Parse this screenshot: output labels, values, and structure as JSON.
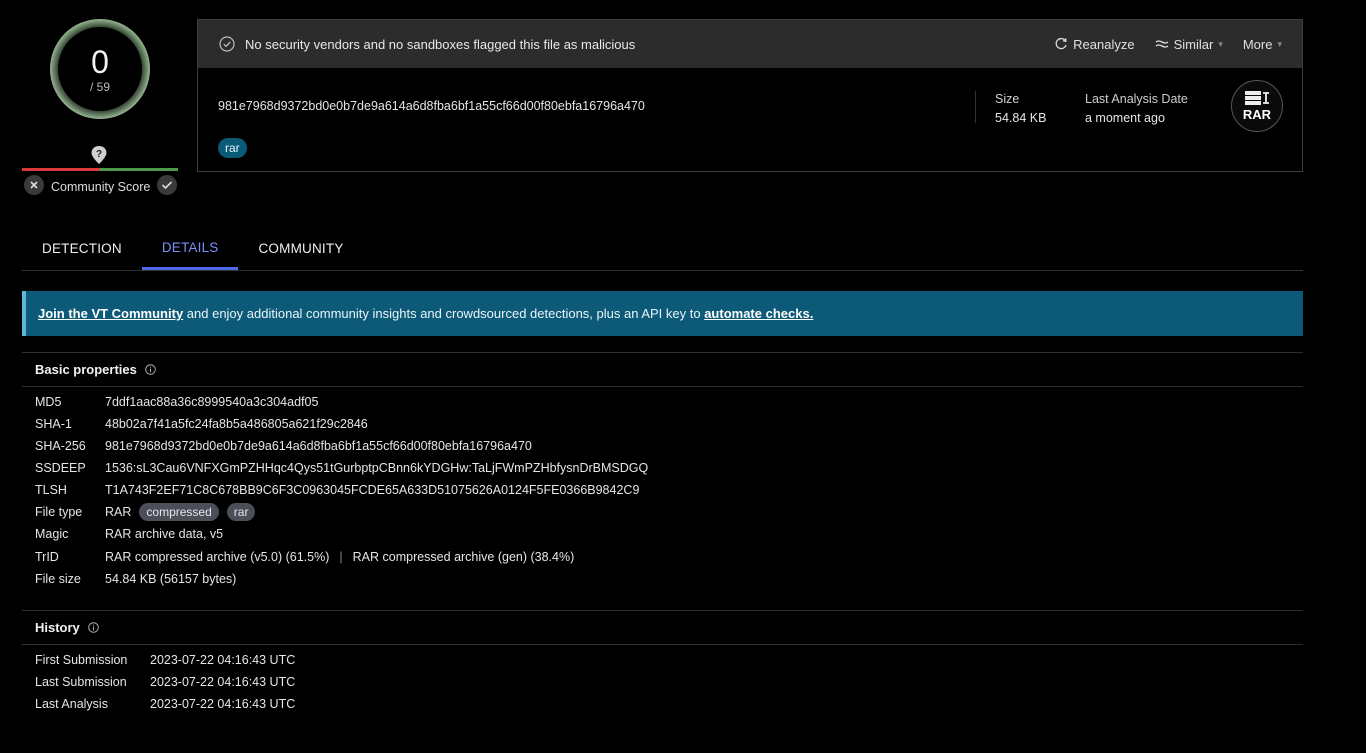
{
  "score": {
    "detections": "0",
    "total": "/ 59"
  },
  "community": {
    "label": "Community Score"
  },
  "banner": {
    "message": "No security vendors and no sandboxes flagged this file as malicious",
    "actions": {
      "reanalyze": "Reanalyze",
      "similar": "Similar",
      "more": "More"
    }
  },
  "file": {
    "hash": "981e7968d9372bd0e0b7de9a614a6d8fba6bf1a55cf66d00f80ebfa16796a470",
    "tag": "rar",
    "size_label": "Size",
    "size_value": "54.84 KB",
    "date_label": "Last Analysis Date",
    "date_value": "a moment ago",
    "type_icon_label": "RAR"
  },
  "tabs": [
    {
      "label": "DETECTION",
      "active": false
    },
    {
      "label": "DETAILS",
      "active": true
    },
    {
      "label": "COMMUNITY",
      "active": false
    }
  ],
  "info_banner": {
    "link1": "Join the VT Community",
    "middle": " and enjoy additional community insights and crowdsourced detections, plus an API key to ",
    "link2": "automate checks."
  },
  "basic": {
    "title": "Basic properties",
    "md5_key": "MD5",
    "md5": "7ddf1aac88a36c8999540a3c304adf05",
    "sha1_key": "SHA-1",
    "sha1": "48b02a7f41a5fc24fa8b5a486805a621f29c2846",
    "sha256_key": "SHA-256",
    "sha256": "981e7968d9372bd0e0b7de9a614a6d8fba6bf1a55cf66d00f80ebfa16796a470",
    "ssdeep_key": "SSDEEP",
    "ssdeep": "1536:sL3Cau6VNFXGmPZHHqc4Qys51tGurbptpCBnn6kYDGHw:TaLjFWmPZHbfysnDrBMSDGQ",
    "tlsh_key": "TLSH",
    "tlsh": "T1A743F2EF71C8C678BB9C6F3C0963045FCDE65A633D51075626A0124F5FE0366B9842C9",
    "filetype_key": "File type",
    "filetype": "RAR",
    "filetype_tags": [
      "compressed",
      "rar"
    ],
    "magic_key": "Magic",
    "magic": "RAR archive data, v5",
    "trid_key": "TrID",
    "trid1": "RAR compressed archive (v5.0) (61.5%)",
    "trid_sep": "|",
    "trid2": "RAR compressed archive (gen) (38.4%)",
    "filesize_key": "File size",
    "filesize": "54.84 KB (56157 bytes)"
  },
  "history": {
    "title": "History",
    "first_key": "First Submission",
    "first": "2023-07-22 04:16:43 UTC",
    "last_key": "Last Submission",
    "last": "2023-07-22 04:16:43 UTC",
    "analysis_key": "Last Analysis",
    "analysis": "2023-07-22 04:16:43 UTC"
  },
  "colors": {
    "accent": "#5067e6",
    "banner_bg": "#0d5a78",
    "tag_bg": "#0b5a78"
  }
}
